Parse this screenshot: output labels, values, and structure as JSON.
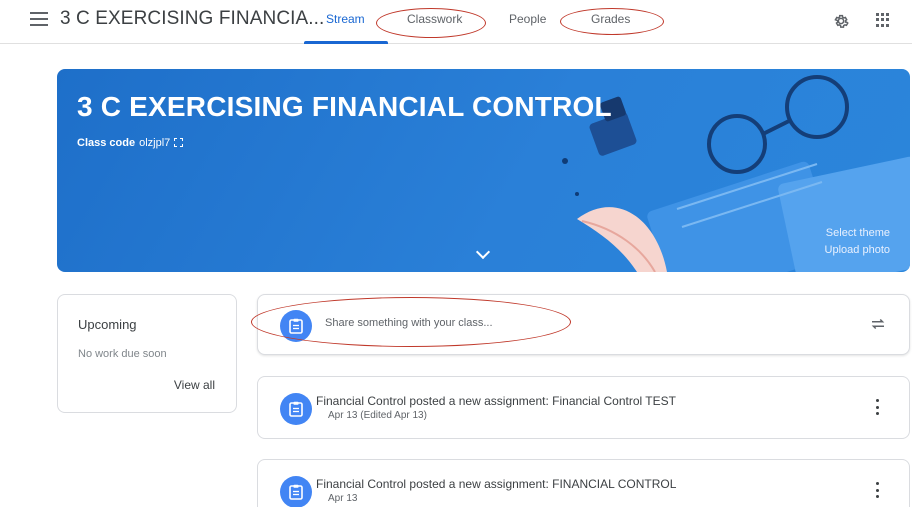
{
  "header": {
    "title": "3 C EXERCISING FINANCIA...",
    "tabs": [
      {
        "label": "Stream",
        "active": true
      },
      {
        "label": "Classwork",
        "active": false
      },
      {
        "label": "People",
        "active": false
      },
      {
        "label": "Grades",
        "active": false
      }
    ],
    "icons": [
      "menu-icon",
      "gear-icon",
      "apps-grid-icon"
    ]
  },
  "banner": {
    "title": "3 C EXERCISING FINANCIAL CONTROL",
    "class_code_label": "Class code",
    "class_code": "olzjpl7",
    "select_theme": "Select theme",
    "upload_photo": "Upload photo"
  },
  "upcoming": {
    "title": "Upcoming",
    "empty_text": "No work due soon",
    "view_all": "View all"
  },
  "share": {
    "placeholder": "Share something with your class..."
  },
  "posts": [
    {
      "author": "Financial Control",
      "text": "posted a new assignment: Financial Control TEST",
      "date": "Apr 13 (Edited Apr 13)"
    },
    {
      "author": "Financial Control",
      "text": "posted a new assignment: FINANCIAL CONTROL",
      "date": "Apr 13"
    }
  ],
  "colors": {
    "accent": "#1967d2",
    "banner": "#2a80d8",
    "avatar": "#4285f4",
    "annotation": "#c0392b"
  }
}
